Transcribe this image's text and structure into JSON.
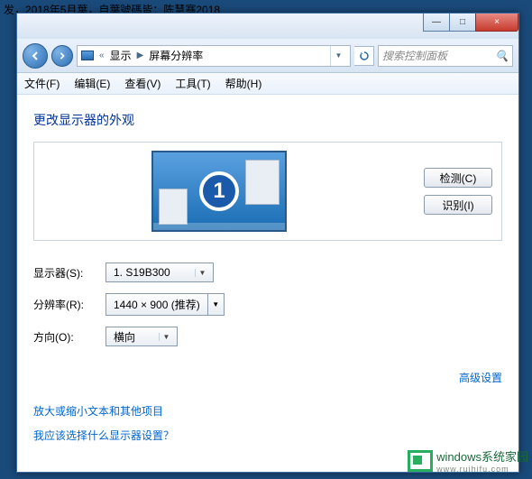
{
  "behind": "发，2018年5月葉，自葉號碼皆：陈慧骞2018",
  "titlebar": {
    "min": "—",
    "max": "□",
    "close": "×"
  },
  "address": {
    "segments": [
      "«",
      "显示",
      "屏幕分辨率"
    ],
    "refresh": "↻"
  },
  "search": {
    "placeholder": "搜索控制面板",
    "icon": "🔍"
  },
  "menubar": [
    "文件(F)",
    "编辑(E)",
    "查看(V)",
    "工具(T)",
    "帮助(H)"
  ],
  "page": {
    "heading": "更改显示器的外观",
    "monitor_number": "1",
    "buttons": {
      "detect": "检测(C)",
      "identify": "识别(I)"
    },
    "labels": {
      "display": "显示器(S):",
      "resolution": "分辨率(R):",
      "orientation": "方向(O):"
    },
    "values": {
      "display": "1. S19B300",
      "resolution": "1440 × 900 (推荐)",
      "orientation": "横向"
    },
    "advanced": "高级设置",
    "links": {
      "text_size": "放大或缩小文本和其他项目",
      "which_settings": "我应该选择什么显示器设置？"
    }
  },
  "watermark": {
    "brand": "windows系统家园",
    "sub": "www.ruihifu.com"
  }
}
